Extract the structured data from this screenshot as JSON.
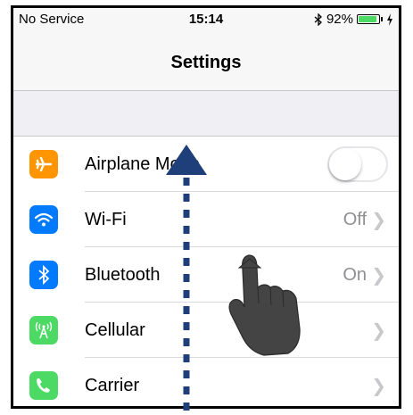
{
  "status_bar": {
    "carrier": "No Service",
    "time": "15:14",
    "battery": "92%",
    "battery_level": 0.92,
    "battery_color": "#4cd964"
  },
  "nav": {
    "title": "Settings"
  },
  "rows": [
    {
      "label": "Airplane Mode",
      "icon": "airplane-icon",
      "icon_color": "#ff9500",
      "control": "toggle",
      "toggle_on": false
    },
    {
      "label": "Wi-Fi",
      "icon": "wifi-icon",
      "icon_color": "#007aff",
      "value": "Off"
    },
    {
      "label": "Bluetooth",
      "icon": "bluetooth-icon",
      "icon_color": "#007aff",
      "value": "On"
    },
    {
      "label": "Cellular",
      "icon": "cellular-icon",
      "icon_color": "#4cd964",
      "value": ""
    },
    {
      "label": "Carrier",
      "icon": "phone-icon",
      "icon_color": "#4cd964",
      "value": ""
    }
  ],
  "overlay": {
    "arrow_color": "#1f3f7a",
    "gesture": "hand-swipe-up-icon"
  }
}
